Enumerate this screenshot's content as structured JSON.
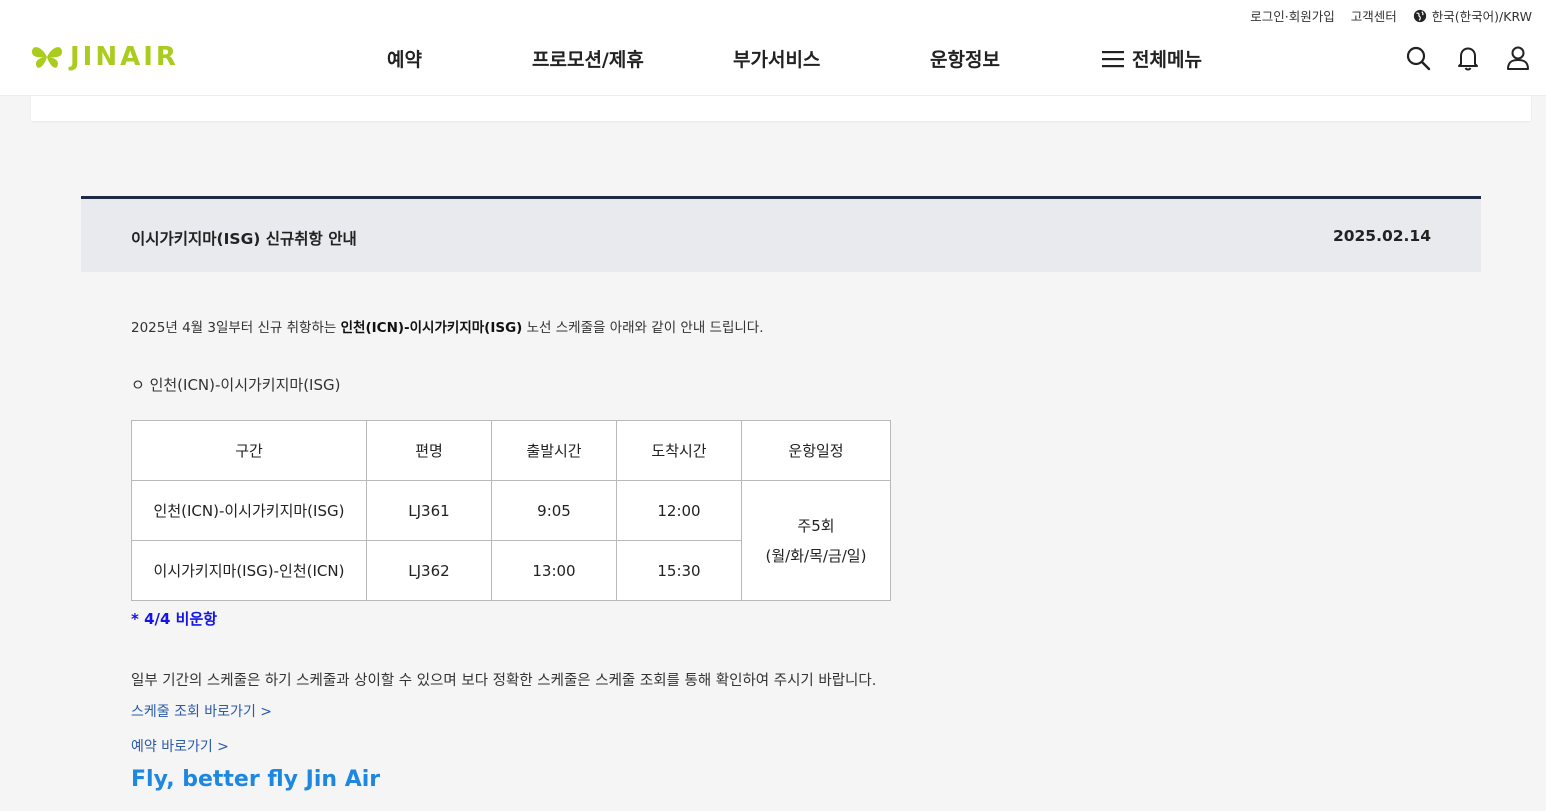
{
  "util": {
    "login": "로그인·회원가입",
    "customer_center": "고객센터",
    "language": "한국(한국어)/KRW"
  },
  "brand": {
    "name": "JINAIR",
    "color": "#aacc1e"
  },
  "nav": {
    "items": [
      "예약",
      "프로모션/제휴",
      "부가서비스",
      "운항정보"
    ],
    "all_menu": "전체메뉴"
  },
  "icons": [
    "search-icon",
    "bell-icon",
    "user-icon",
    "globe-icon",
    "hamburger-icon",
    "butterfly-logo-icon"
  ],
  "notice": {
    "title": "이시가키지마(ISG) 신규취항 안내",
    "date": "2025.02.14",
    "intro_prefix": "2025년 4월 3일부터 신규 취항하는 ",
    "intro_bold": "인천(ICN)-이시가키지마(ISG)",
    "intro_suffix": " 노선 스케줄을 아래와 같이 안내 드립니다.",
    "route_heading": "ㅇ 인천(ICN)-이시가키지마(ISG)",
    "table": {
      "headers": [
        "구간",
        "편명",
        "출발시간",
        "도착시간",
        "운항일정"
      ],
      "rows": [
        {
          "segment": "인천(ICN)-이시가키지마(ISG)",
          "flight": "LJ361",
          "depart": "9:05",
          "arrive": "12:00"
        },
        {
          "segment": "이시가키지마(ISG)-인천(ICN)",
          "flight": "LJ362",
          "depart": "13:00",
          "arrive": "15:30"
        }
      ],
      "schedule_line1": "주5회",
      "schedule_line2": "(월/화/목/금/일)"
    },
    "note": "* 4/4 비운항",
    "disclaimer": "일부 기간의 스케줄은 하기 스케줄과 상이할 수 있으며 보다 정확한 스케줄은 스케줄 조회를 통해 확인하여 주시기 바랍니다.",
    "link_schedule": "스케줄 조회 바로가기 >",
    "link_booking": "예약 바로가기 >",
    "slogan": "Fly, better fly Jin Air"
  },
  "colors": {
    "note_blue": "#1414e6",
    "link_blue": "#2a5aa8",
    "slogan_blue": "#1e88e0",
    "title_border": "#1c2a44"
  }
}
